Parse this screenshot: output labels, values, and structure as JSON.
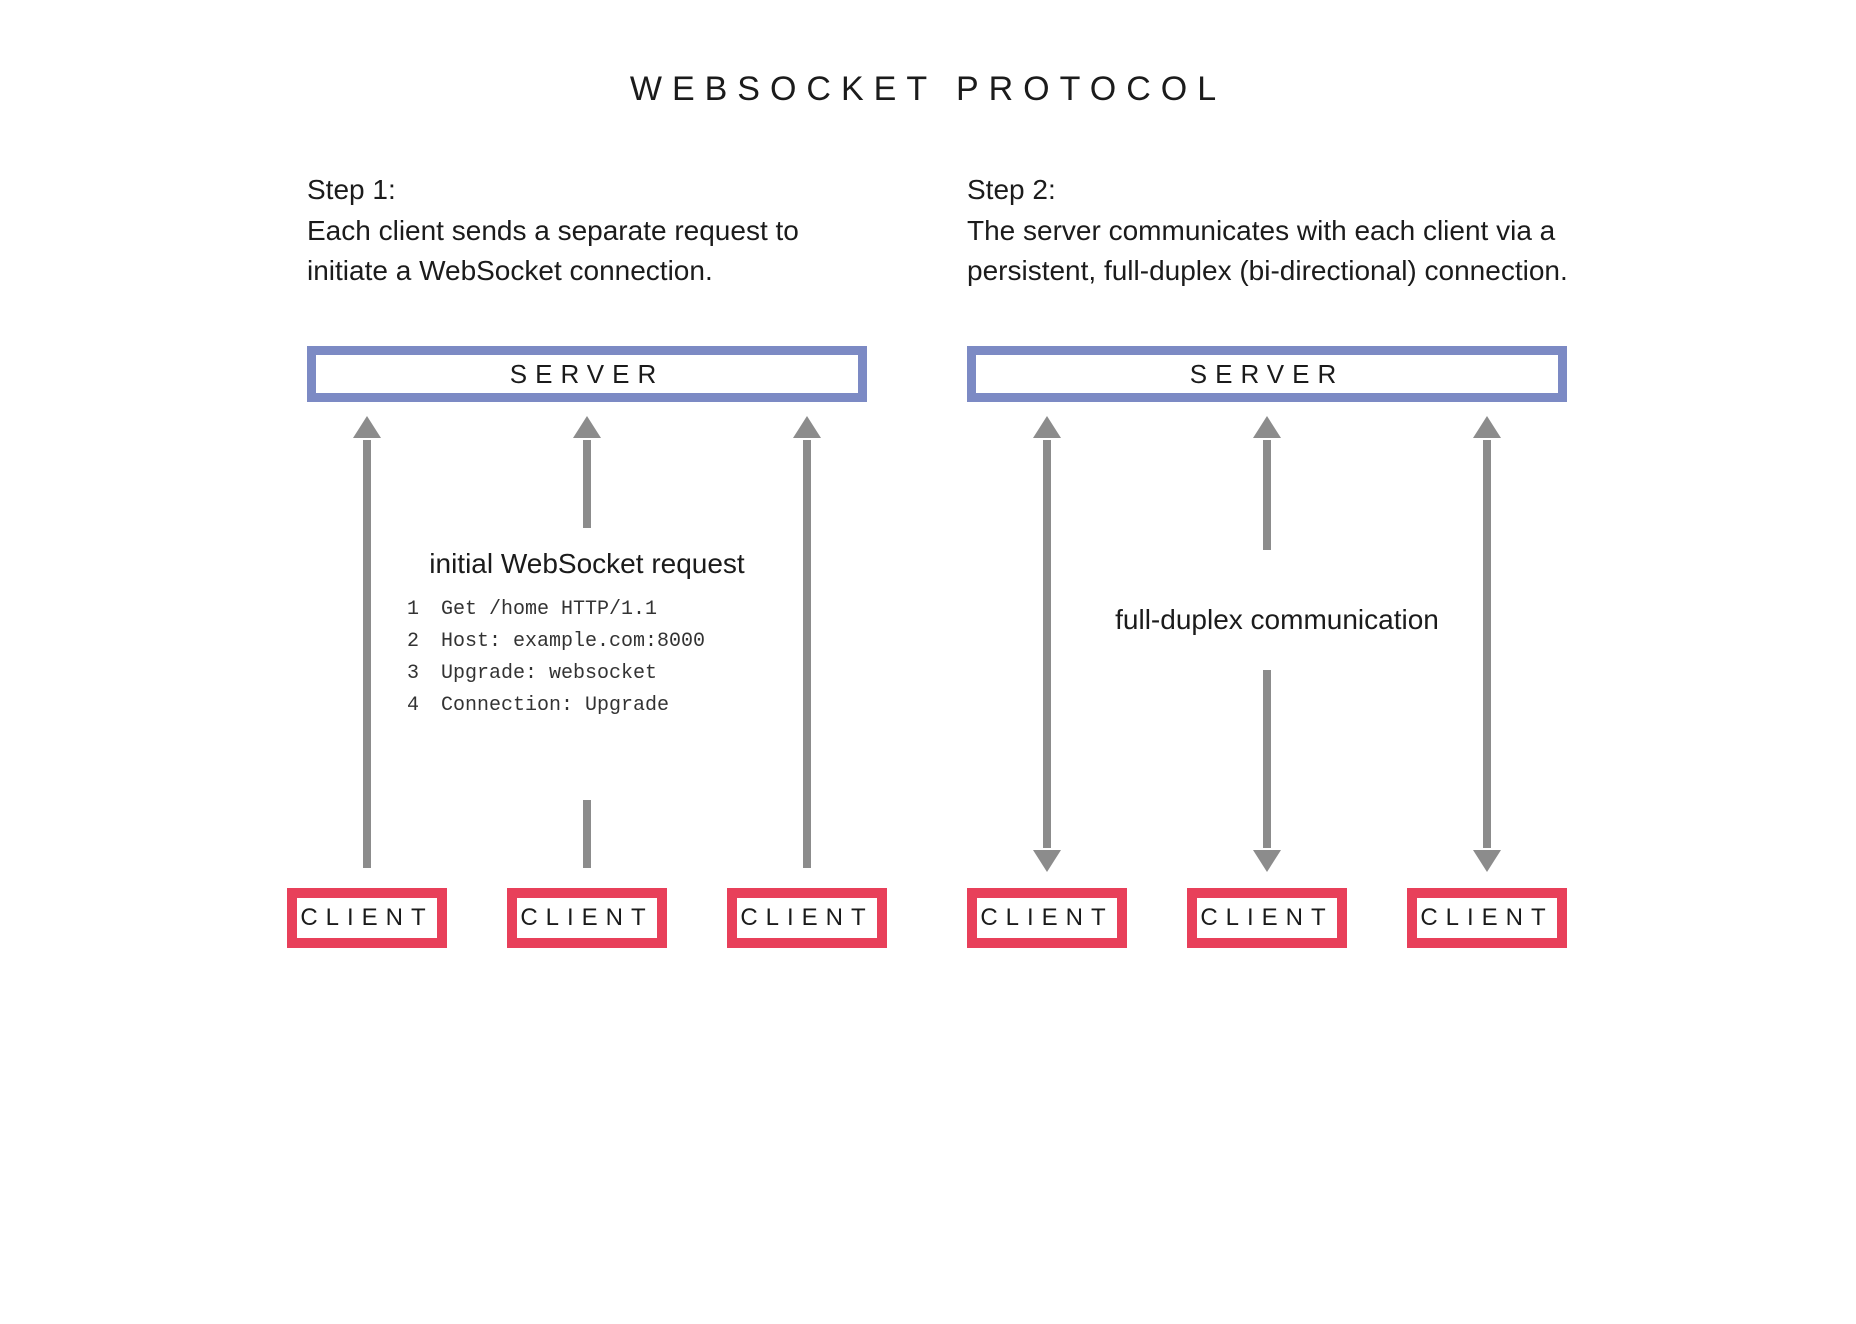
{
  "title": "WEBSOCKET PROTOCOL",
  "step1": {
    "heading": "Step 1:",
    "body": "Each client sends a separate request to initiate a WebSocket connection.",
    "server": "SERVER",
    "clients": [
      "CLIENT",
      "CLIENT",
      "CLIENT"
    ],
    "request_caption": "initial WebSocket request",
    "request_lines": [
      "Get /home HTTP/1.1",
      "Host: example.com:8000",
      "Upgrade: websocket",
      "Connection: Upgrade"
    ]
  },
  "step2": {
    "heading": "Step 2:",
    "body": "The server communicates with each client via a persistent, full-duplex (bi-directional) connection.",
    "server": "SERVER",
    "clients": [
      "CLIENT",
      "CLIENT",
      "CLIENT"
    ],
    "mid_caption": "full-duplex communication"
  },
  "colors": {
    "server_border": "#7c8ac4",
    "client_border": "#e8405a",
    "arrow": "#8c8c8c"
  }
}
